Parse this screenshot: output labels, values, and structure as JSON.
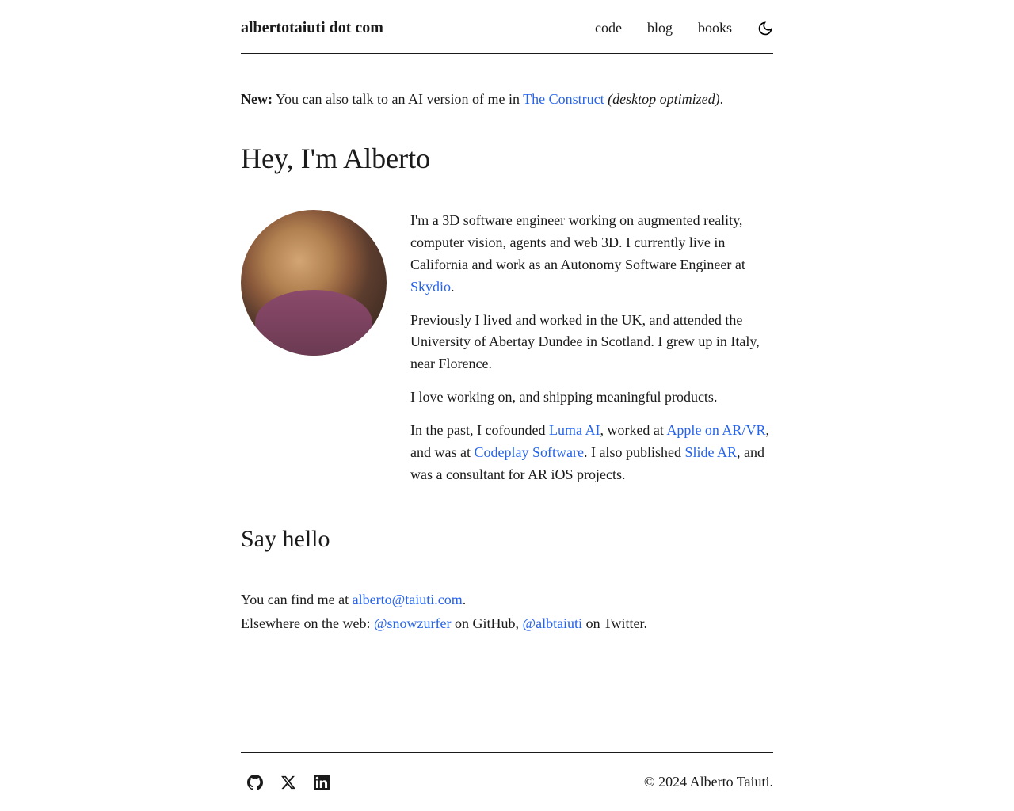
{
  "header": {
    "site_title": "albertotaiuti dot com",
    "nav": {
      "code": "code",
      "blog": "blog",
      "books": "books"
    }
  },
  "banner": {
    "new_label": "New:",
    "text_before": " You can also talk to an AI version of me in ",
    "link_text": "The Construct",
    "text_after_italic": "(desktop optimized)",
    "period": "."
  },
  "main_heading": "Hey, I'm Alberto",
  "intro": {
    "p1_before": "I'm a 3D software engineer working on augmented reality, computer vision, agents and web 3D. I currently live in California and work as an Autonomy Software Engineer at ",
    "p1_link": "Skydio",
    "p1_after": ".",
    "p2": "Previously I lived and worked in the UK, and attended the University of Abertay Dundee in Scotland. I grew up in Italy, near Florence.",
    "p3": "I love working on, and shipping meaningful products.",
    "p4_a": "In the past, I cofounded ",
    "p4_luma": "Luma AI",
    "p4_b": ", worked at ",
    "p4_apple": "Apple on AR/VR",
    "p4_c": ", and was at ",
    "p4_codeplay": "Codeplay Software",
    "p4_d": ". I also published ",
    "p4_slide": "Slide AR",
    "p4_e": ", and was a consultant for AR iOS projects."
  },
  "say_hello_heading": "Say hello",
  "contact": {
    "p1_before": "You can find me at ",
    "email": "alberto@taiuti.com",
    "p1_after": ".",
    "p2_a": "Elsewhere on the web: ",
    "github_handle": "@snowzurfer",
    "p2_b": " on GitHub, ",
    "twitter_handle": "@albtaiuti",
    "p2_c": " on Twitter."
  },
  "footer": {
    "copyright": "© 2024 Alberto Taiuti."
  }
}
